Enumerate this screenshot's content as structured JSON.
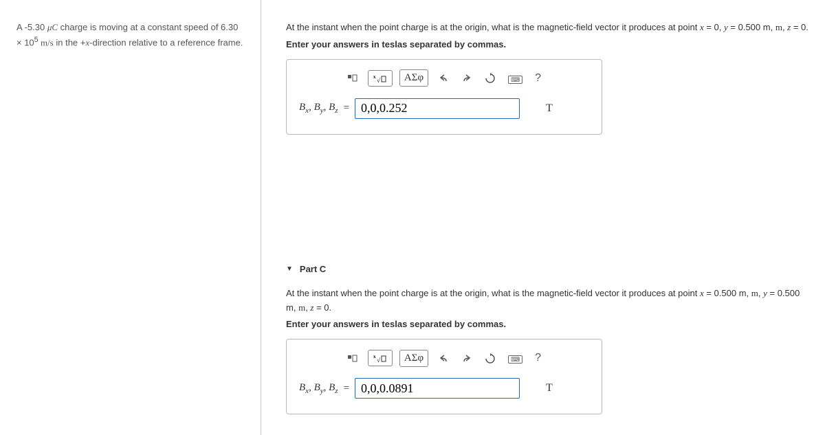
{
  "sidebar": {
    "text_pre": "A -5.30 ",
    "unit_muC": "μC",
    "text_mid1": " charge is moving at a constant speed of 6.30 × 10",
    "exp": "5",
    "text_mid2": " m/s",
    "text_mid3": " in the +",
    "var_x": "x",
    "text_end": "-direction relative to a reference frame."
  },
  "partB": {
    "q_pre": "At the instant when the point charge is at the origin, what is the magnetic-field vector it produces at point ",
    "eq1_var": "x",
    "eq1_rest": " = 0, ",
    "eq2_var": "y",
    "eq2_rest": " = 0.500 m, ",
    "eq3_var": "z",
    "eq3_rest": " = 0.",
    "instruction": "Enter your answers in teslas separated by commas.",
    "toolbar": {
      "greek": "ΑΣφ",
      "help": "?"
    },
    "varlabel": "Bₓ, Bᵧ, B_z",
    "eq": "=",
    "value": "0,0,0.252",
    "unit": "T"
  },
  "partC": {
    "title": "Part C",
    "q_pre": "At the instant when the point charge is at the origin, what is the magnetic-field vector it produces at point ",
    "eq1_var": "x",
    "eq1_rest": " = 0.500 m, ",
    "eq2_var": "y",
    "eq2_rest": " = 0.500 m, ",
    "eq3_var": "z",
    "eq3_rest": " = 0.",
    "instruction": "Enter your answers in teslas separated by commas.",
    "toolbar": {
      "greek": "ΑΣφ",
      "help": "?"
    },
    "eq": "=",
    "value": "0,0,0.0891",
    "unit": "T"
  }
}
